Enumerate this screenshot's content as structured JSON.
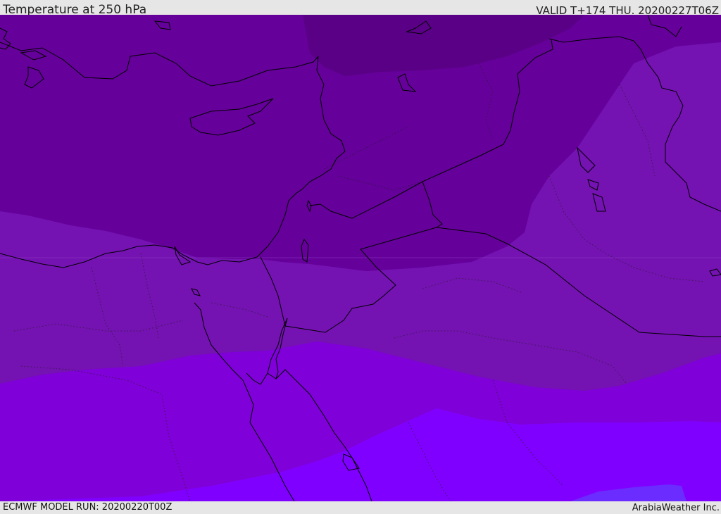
{
  "header": {
    "title": "Temperature at 250 hPa",
    "valid_time": "VALID T+174 THU. 20200227T06Z"
  },
  "footer": {
    "model_run": "ECMWF MODEL RUN: 20200220T00Z",
    "credit": "ArabiaWeather Inc."
  },
  "map": {
    "variable": "temperature",
    "level": "250 hPa",
    "bands": [
      {
        "name": "darkest",
        "color": "#5a0086"
      },
      {
        "name": "dark",
        "color": "#65009a"
      },
      {
        "name": "medium",
        "color": "#7412b2"
      },
      {
        "name": "light",
        "color": "#7f00d8"
      },
      {
        "name": "lighter",
        "color": "#8000ff"
      },
      {
        "name": "lightest",
        "color": "#6a2cff"
      }
    ],
    "coastline_color": "#000000"
  }
}
